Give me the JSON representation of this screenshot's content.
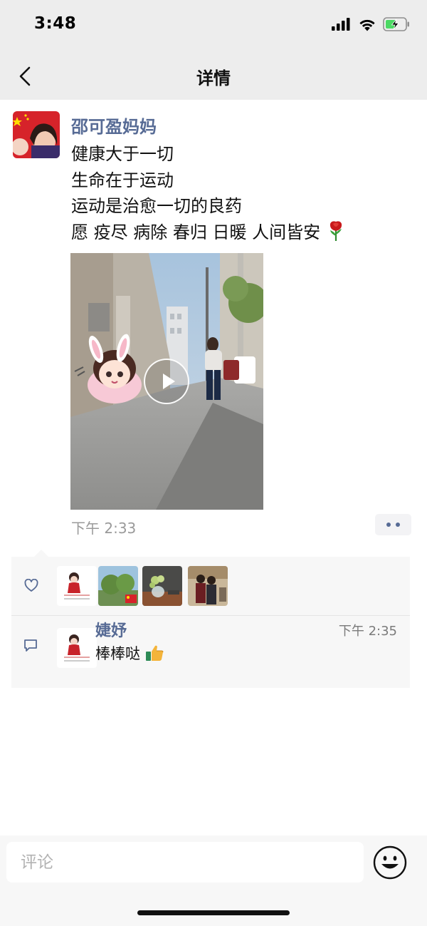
{
  "status": {
    "time": "3:48"
  },
  "nav": {
    "title": "详情"
  },
  "post": {
    "author": "邵可盈妈妈",
    "lines": [
      "健康大于一切",
      "生命在于运动",
      "运动是治愈一切的良药",
      "愿 疫尽 病除 春归 日暖 人间皆安"
    ],
    "time": "下午 2:33"
  },
  "comments": [
    {
      "author": "婕妤",
      "time": "下午 2:35",
      "text": "棒棒哒"
    }
  ],
  "input": {
    "placeholder": "评论"
  },
  "colors": {
    "link": "#576b95",
    "nav_bg": "#ededed",
    "panel_bg": "#f7f7f7"
  }
}
